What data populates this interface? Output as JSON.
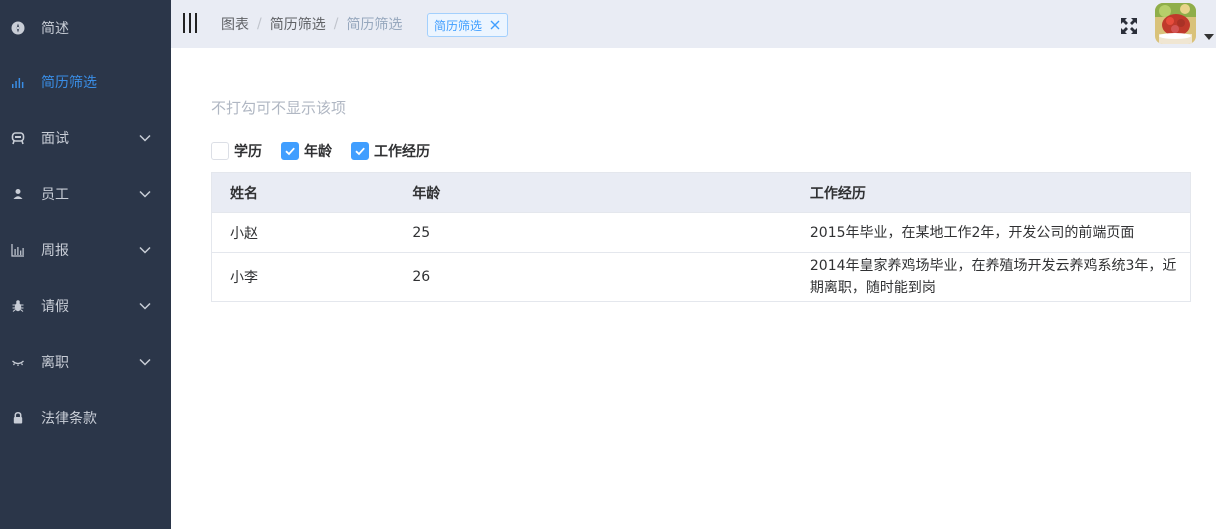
{
  "sidebar": {
    "items": [
      {
        "label": "简述",
        "icon": "compass-icon",
        "active": false,
        "expandable": false
      },
      {
        "label": "简历筛选",
        "icon": "bar-chart-icon",
        "active": true,
        "expandable": false
      },
      {
        "label": "面试",
        "icon": "robot-icon",
        "active": false,
        "expandable": true
      },
      {
        "label": "员工",
        "icon": "user-icon",
        "active": false,
        "expandable": true
      },
      {
        "label": "周报",
        "icon": "chart-icon",
        "active": false,
        "expandable": true
      },
      {
        "label": "请假",
        "icon": "bug-icon",
        "active": false,
        "expandable": true
      },
      {
        "label": "离职",
        "icon": "eye-closed-icon",
        "active": false,
        "expandable": true
      },
      {
        "label": "法律条款",
        "icon": "lock-icon",
        "active": false,
        "expandable": false
      }
    ]
  },
  "header": {
    "breadcrumb": [
      "图表",
      "简历筛选",
      "简历筛选"
    ],
    "tag": "简历筛选"
  },
  "main": {
    "tip": "不打勾可不显示该项",
    "checkboxes": [
      {
        "label": "学历",
        "checked": false
      },
      {
        "label": "年龄",
        "checked": true
      },
      {
        "label": "工作经历",
        "checked": true
      }
    ],
    "table": {
      "headers": [
        "姓名",
        "年龄",
        "工作经历"
      ],
      "rows": [
        [
          "小赵",
          "25",
          "2015年毕业，在某地工作2年，开发公司的前端页面"
        ],
        [
          "小李",
          "26",
          "2014年皇家养鸡场毕业，在养殖场开发云养鸡系统3年，近期离职，随时能到岗"
        ]
      ]
    }
  },
  "colors": {
    "sidebar_bg": "#2b3649",
    "header_bg": "#e9ecf4",
    "accent": "#409eff",
    "active_text": "#3a8ee6"
  }
}
